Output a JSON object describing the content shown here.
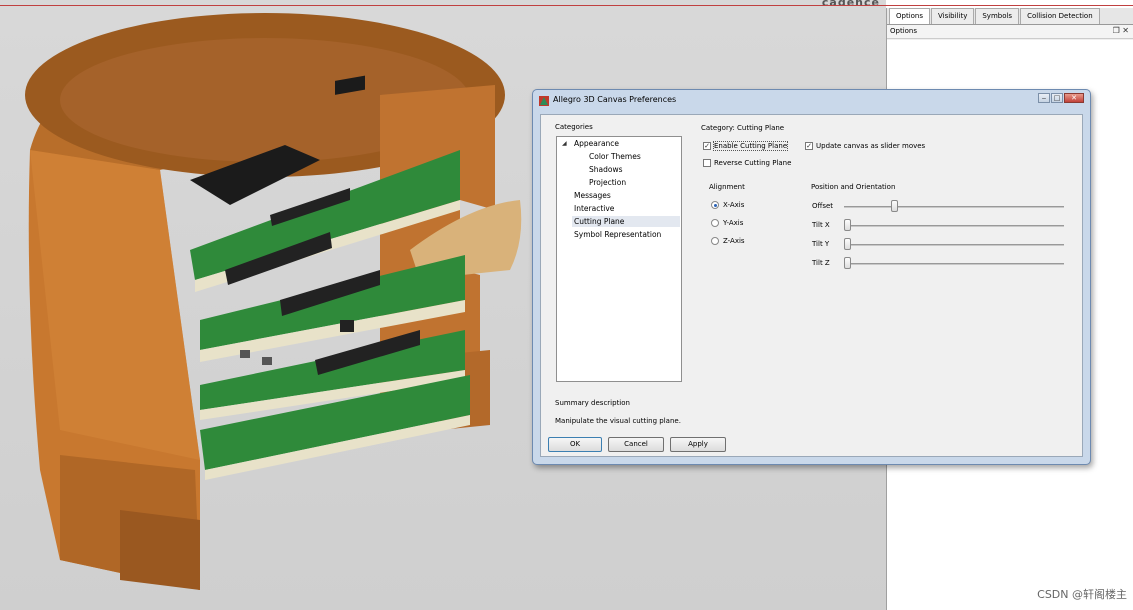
{
  "brand": "cadence",
  "watermark": "CSDN @轩阁楼主",
  "dock": {
    "tabs": [
      "Options",
      "Visibility",
      "Symbols",
      "Collision Detection"
    ],
    "active_tab": "Options",
    "header": "Options",
    "controls": [
      "pin-icon",
      "close-icon"
    ]
  },
  "dialog": {
    "title": "Allegro 3D Canvas Preferences",
    "categories_label": "Categories",
    "tree": [
      {
        "label": "Appearance",
        "expanded": true
      },
      {
        "label": "Color Themes"
      },
      {
        "label": "Shadows"
      },
      {
        "label": "Projection"
      },
      {
        "label": "Messages"
      },
      {
        "label": "Interactive"
      },
      {
        "label": "Cutting Plane",
        "selected": true
      },
      {
        "label": "Symbol Representation"
      }
    ],
    "category_heading": "Category: Cutting Plane",
    "enable_cutting_plane": {
      "label": "Enable Cutting Plane",
      "checked": true
    },
    "update_canvas": {
      "label": "Update canvas as slider moves",
      "checked": true
    },
    "reverse_cutting_plane": {
      "label": "Reverse Cutting Plane",
      "checked": false
    },
    "alignment_label": "Alignment",
    "alignment_options": [
      {
        "label": "X-Axis",
        "selected": true
      },
      {
        "label": "Y-Axis",
        "selected": false
      },
      {
        "label": "Z-Axis",
        "selected": false
      }
    ],
    "position_label": "Position and Orientation",
    "sliders": [
      {
        "label": "Offset",
        "value": 0.22
      },
      {
        "label": "Tilt X",
        "value": 0.0
      },
      {
        "label": "Tilt Y",
        "value": 0.0
      },
      {
        "label": "Tilt Z",
        "value": 0.0
      }
    ],
    "summary_label": "Summary description",
    "summary_text": "Manipulate the visual cutting plane.",
    "buttons": {
      "ok": "OK",
      "cancel": "Cancel",
      "apply": "Apply"
    }
  },
  "colors": {
    "enclosure": "#c8782f",
    "pcb": "#2f8a3a",
    "canvas_bg": "#d4d4d4",
    "dialog_frame": "#c9d8ea"
  }
}
